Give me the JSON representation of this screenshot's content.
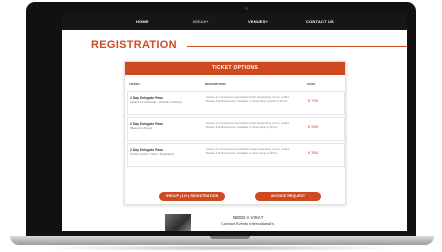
{
  "nav": {
    "items": [
      "HOME",
      "IDEAS",
      "VENUES",
      "CONTACT US"
    ],
    "dropdown_marker": "+"
  },
  "page": {
    "heading": "REGISTRATION"
  },
  "ticket_options": {
    "title": "TICKET OPTIONS",
    "columns": [
      "TICKET",
      "DESCRIPTION",
      "COST"
    ],
    "rows": [
      {
        "name": "2 Day Delegate Pass",
        "sub": "(Stand membership - Outside of Africa)",
        "description": "Access To Conference & Exhibition Daily Networking Lunch, Coffee Breaks & Refreshments. Available to those living outside of Africa.",
        "price": "€ 795"
      },
      {
        "name": "2 Day Delegate Pass",
        "sub": "(Based in Africa)",
        "description": "Access To Conference & Exhibition Daily Networking Lunch, Coffee Breaks & Refreshments. Available to those living in Africa.",
        "price": "€ 595"
      },
      {
        "name": "2 Day Delegate Pass",
        "sub": "(Public sector / NGO / Regulator)",
        "description": "Access To Conference & Exhibition Daily Networking Lunch, Coffee Breaks & Refreshments. Available to those living in Africa.",
        "price": "€ 395"
      }
    ]
  },
  "buttons": {
    "group": "GROUP (10+) REGISTRATION",
    "invoice": "INVOICE REQUEST"
  },
  "promo": {
    "title": "NEED A VISA?",
    "line": "Contact Events International's"
  },
  "colors": {
    "accent": "#cf4a20",
    "nav_bg": "#161616"
  }
}
